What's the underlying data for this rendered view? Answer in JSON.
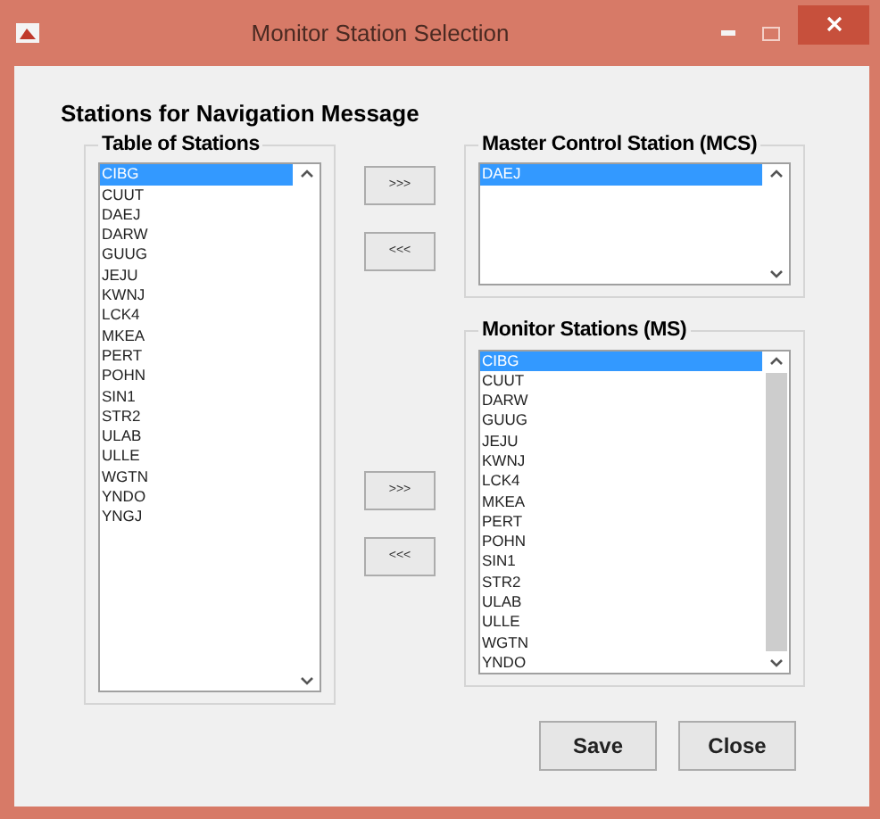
{
  "window": {
    "title": "Monitor Station Selection"
  },
  "heading": "Stations for Navigation Message",
  "table_of_stations": {
    "title": "Table of Stations",
    "items": [
      {
        "label": "CIBG",
        "selected": true
      },
      {
        "label": "CUUT",
        "selected": false
      },
      {
        "label": "DAEJ",
        "selected": false
      },
      {
        "label": "DARW",
        "selected": false
      },
      {
        "label": "GUUG",
        "selected": false
      },
      {
        "label": "JEJU",
        "selected": false
      },
      {
        "label": "KWNJ",
        "selected": false
      },
      {
        "label": "LCK4",
        "selected": false
      },
      {
        "label": "MKEA",
        "selected": false
      },
      {
        "label": "PERT",
        "selected": false
      },
      {
        "label": "POHN",
        "selected": false
      },
      {
        "label": "SIN1",
        "selected": false
      },
      {
        "label": "STR2",
        "selected": false
      },
      {
        "label": "ULAB",
        "selected": false
      },
      {
        "label": "ULLE",
        "selected": false
      },
      {
        "label": "WGTN",
        "selected": false
      },
      {
        "label": "YNDO",
        "selected": false
      },
      {
        "label": "YNGJ",
        "selected": false
      }
    ]
  },
  "mcs_buttons": [
    ">>>",
    "<<<"
  ],
  "ms_buttons": [
    ">>>",
    "<<<"
  ],
  "master_control_station": {
    "title": "Master Control Station (MCS)",
    "items": [
      {
        "label": "DAEJ",
        "selected": true
      }
    ]
  },
  "monitor_stations": {
    "title": "Monitor Stations (MS)",
    "items": [
      {
        "label": "CIBG",
        "selected": true
      },
      {
        "label": "CUUT",
        "selected": false
      },
      {
        "label": "DARW",
        "selected": false
      },
      {
        "label": "GUUG",
        "selected": false
      },
      {
        "label": "JEJU",
        "selected": false
      },
      {
        "label": "KWNJ",
        "selected": false
      },
      {
        "label": "LCK4",
        "selected": false
      },
      {
        "label": "MKEA",
        "selected": false
      },
      {
        "label": "PERT",
        "selected": false
      },
      {
        "label": "POHN",
        "selected": false
      },
      {
        "label": "SIN1",
        "selected": false
      },
      {
        "label": "STR2",
        "selected": false
      },
      {
        "label": "ULAB",
        "selected": false
      },
      {
        "label": "ULLE",
        "selected": false
      },
      {
        "label": "WGTN",
        "selected": false
      },
      {
        "label": "YNDO",
        "selected": false
      }
    ]
  },
  "buttons": [
    "Save",
    "Close"
  ]
}
